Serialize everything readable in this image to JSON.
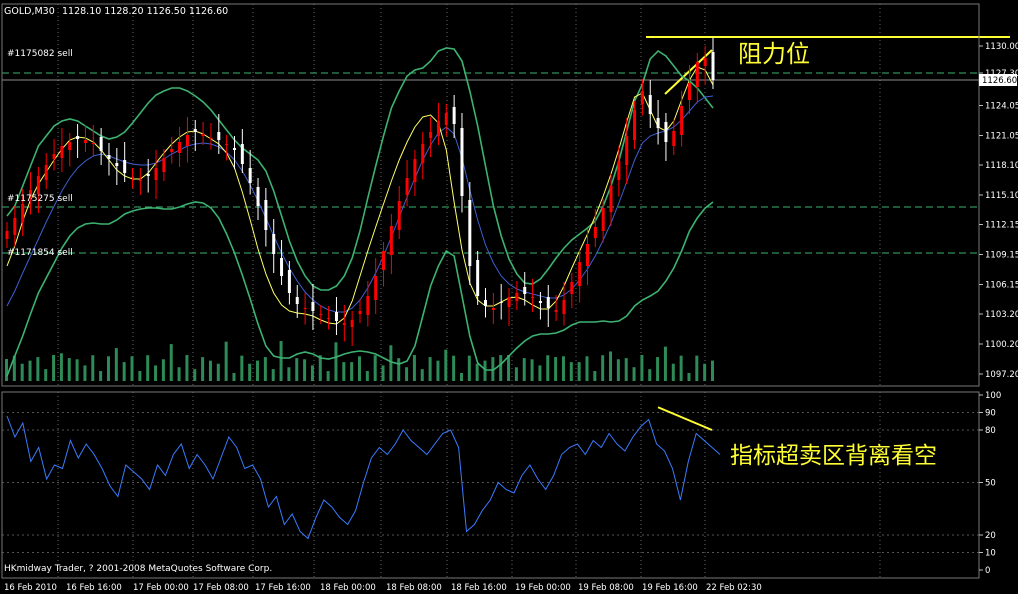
{
  "header": {
    "symbol_timeframe": "GOLD,M30",
    "ohlc": "1128.10 1128.20 1126.50 1126.60"
  },
  "orders": [
    {
      "label": "#1175082 sell",
      "price": 1127.3
    },
    {
      "label": "#1175275 sell",
      "price": 1113.9
    },
    {
      "label": "#1171854 sell",
      "price": 1109.3
    }
  ],
  "annotations": {
    "resistance": "阻力位",
    "divergence": "指标超卖区背离看空"
  },
  "footer": {
    "copyright": "HKmidway Trader, ? 2001-2008 MetaQuotes Software Corp."
  },
  "colors": {
    "background": "#000000",
    "bull_candle": "#ff0000",
    "bear_candle": "#ffffff",
    "bollinger": "#3cb371",
    "ma_yellow": "#ffff66",
    "ma_blue": "#3d5fd0",
    "oscillator": "#3a7bff",
    "annotation": "#ffff33",
    "grid": "#3cb371"
  },
  "chart_data": [
    {
      "type": "candlestick",
      "symbol": "GOLD",
      "timeframe": "M30",
      "ylim": [
        1096.5,
        1131.6
      ],
      "price_ticks": [
        "1130.00",
        "1127.30",
        "1124.05",
        "1121.05",
        "1118.10",
        "1115.10",
        "1112.15",
        "1109.15",
        "1106.15",
        "1103.20",
        "1100.20",
        "1097.20"
      ],
      "current_price_label": "1126.60",
      "resistance_level": 1130.9,
      "x_ticks": [
        "16 Feb 2010",
        "16 Feb 16:00",
        "17 Feb 00:00",
        "17 Feb 08:00",
        "17 Feb 16:00",
        "18 Feb 00:00",
        "18 Feb 08:00",
        "18 Feb 16:00",
        "19 Feb 00:00",
        "19 Feb 08:00",
        "19 Feb 16:00",
        "22 Feb 02:30"
      ],
      "close": [
        1111.5,
        1112.8,
        1114.2,
        1115.6,
        1117.0,
        1118.1,
        1119.2,
        1120.0,
        1120.4,
        1120.7,
        1120.6,
        1120.3,
        1119.5,
        1118.7,
        1118.0,
        1117.3,
        1116.9,
        1116.6,
        1117.0,
        1117.8,
        1118.8,
        1119.7,
        1120.4,
        1121.1,
        1121.4,
        1121.2,
        1120.8,
        1120.6,
        1120.2,
        1119.6,
        1118.2,
        1116.3,
        1114.0,
        1111.6,
        1109.2,
        1107.0,
        1105.3,
        1104.2,
        1103.8,
        1103.5,
        1103.2,
        1102.8,
        1102.5,
        1102.3,
        1102.6,
        1103.5,
        1105.0,
        1107.0,
        1109.5,
        1112.0,
        1114.5,
        1116.8,
        1118.7,
        1120.2,
        1121.4,
        1122.5,
        1123.3,
        1122.2,
        1115.0,
        1108.0,
        1105.0,
        1104.0,
        1103.8,
        1104.3,
        1104.9,
        1105.3,
        1105.2,
        1104.9,
        1104.3,
        1103.8,
        1103.6,
        1104.6,
        1106.4,
        1108.4,
        1110.2,
        1111.9,
        1113.8,
        1116.0,
        1118.5,
        1121.0,
        1123.6,
        1125.5,
        1123.2,
        1121.8,
        1120.4,
        1121.5,
        1124.0,
        1126.3,
        1128.4,
        1128.8,
        1126.6
      ],
      "bollinger_upper": [
        1113,
        1114,
        1116,
        1118,
        1120,
        1121,
        1122,
        1122.5,
        1122.7,
        1122.5,
        1122,
        1121.5,
        1121,
        1120.7,
        1120.9,
        1121.4,
        1122.3,
        1123.3,
        1124.3,
        1125.1,
        1125.5,
        1125.8,
        1125.8,
        1125.5,
        1125,
        1124.4,
        1123.6,
        1122.6,
        1121.6,
        1120.6,
        1119.8,
        1119.2,
        1118.6,
        1117.5,
        1115.5,
        1113,
        1110.5,
        1108.5,
        1107,
        1106,
        1105.6,
        1105.6,
        1106,
        1107,
        1108.8,
        1111.5,
        1114.8,
        1118,
        1121,
        1123.8,
        1125.5,
        1127,
        1127.6,
        1127.8,
        1128.5,
        1129.5,
        1129.8,
        1129.7,
        1128.5,
        1125.5,
        1122,
        1118,
        1114,
        1111,
        1108.7,
        1107.2,
        1106.3,
        1106.2,
        1106.7,
        1107.7,
        1108.8,
        1109.8,
        1110.6,
        1111.2,
        1111.8,
        1112.5,
        1114,
        1116,
        1118.5,
        1121.5,
        1124.5,
        1126.2,
        1128.7,
        1129.5,
        1129,
        1128,
        1127,
        1126.5,
        1125.8,
        1124.8,
        1123.8
      ],
      "bollinger_lower": [
        1097,
        1099,
        1101,
        1103.2,
        1105.3,
        1106.8,
        1108.3,
        1109.8,
        1111,
        1111.8,
        1112.2,
        1112.3,
        1112.2,
        1112.2,
        1112.6,
        1113.2,
        1113.5,
        1113.7,
        1113.8,
        1113.8,
        1113.7,
        1113.7,
        1113.9,
        1114.2,
        1114.4,
        1114.3,
        1113.8,
        1112.8,
        1111.2,
        1109.3,
        1107.1,
        1104.7,
        1102.2,
        1100,
        1099,
        1098.8,
        1098.8,
        1099.2,
        1099.4,
        1099.2,
        1098.8,
        1098.7,
        1098.9,
        1099.2,
        1099.4,
        1099.5,
        1099.4,
        1099.2,
        1098.8,
        1098.4,
        1098.2,
        1098.5,
        1100,
        1103,
        1106,
        1108,
        1109.5,
        1109,
        1105,
        1101,
        1098.3,
        1097.6,
        1097.6,
        1098.2,
        1099,
        1099.8,
        1100.5,
        1101,
        1101.2,
        1101.2,
        1101.3,
        1101.6,
        1102.1,
        1102.4,
        1102.4,
        1102.4,
        1102.5,
        1102.4,
        1102.5,
        1103,
        1104,
        1104.6,
        1105,
        1105.5,
        1106.5,
        1107.8,
        1109.5,
        1111.5,
        1112.8,
        1113.8,
        1114.4
      ],
      "ma_fast": [
        1108,
        1110,
        1112.5,
        1114.6,
        1116.2,
        1117.4,
        1118.6,
        1119.7,
        1120.6,
        1120.9,
        1120.8,
        1120.4,
        1119.6,
        1118.6,
        1117.6,
        1117,
        1116.7,
        1116.7,
        1117.3,
        1118.3,
        1119.3,
        1120.2,
        1120.9,
        1121.4,
        1121.5,
        1121.2,
        1120.7,
        1120.2,
        1119.3,
        1117.8,
        1115.4,
        1112.6,
        1109.7,
        1107.2,
        1105.3,
        1104.1,
        1103.5,
        1103.3,
        1103.2,
        1103,
        1102.6,
        1102.3,
        1102.2,
        1102.8,
        1104.5,
        1107,
        1109.5,
        1111.9,
        1114.2,
        1116.5,
        1118.6,
        1120.4,
        1121.9,
        1122.9,
        1123.1,
        1122.3,
        1119.6,
        1114.4,
        1109.6,
        1106.3,
        1104.6,
        1104,
        1104,
        1104.4,
        1104.8,
        1104.9,
        1104.6,
        1104.1,
        1103.7,
        1103.7,
        1104.5,
        1106,
        1107.8,
        1109.5,
        1111.2,
        1113,
        1115,
        1117.2,
        1119.7,
        1122.4,
        1124.9,
        1125.3,
        1123.6,
        1121.9,
        1121.5,
        1122.5,
        1124.6,
        1126.6,
        1127.9,
        1127.6,
        1126.1
      ],
      "ma_blue": [
        1104,
        1105.5,
        1107.3,
        1109,
        1110.7,
        1112.4,
        1114,
        1115.5,
        1116.8,
        1117.8,
        1118.5,
        1119,
        1119.2,
        1119,
        1118.7,
        1118.4,
        1118.2,
        1118.1,
        1118.1,
        1118.3,
        1118.7,
        1119.2,
        1119.6,
        1120,
        1120.2,
        1120.3,
        1120.2,
        1119.9,
        1119.4,
        1118.6,
        1117.5,
        1116.1,
        1114.5,
        1112.8,
        1111,
        1109.3,
        1107.8,
        1106.5,
        1105.4,
        1104.6,
        1104,
        1103.6,
        1103.4,
        1103.4,
        1103.8,
        1104.6,
        1105.8,
        1107.3,
        1109,
        1110.9,
        1112.9,
        1114.9,
        1116.8,
        1118.6,
        1120.1,
        1121.3,
        1121.9,
        1121.2,
        1118.8,
        1115.6,
        1112.6,
        1110.1,
        1108.3,
        1107,
        1106.2,
        1105.7,
        1105.4,
        1105.2,
        1105,
        1104.8,
        1104.8,
        1105.1,
        1105.7,
        1106.6,
        1107.7,
        1109,
        1110.6,
        1112.3,
        1114.3,
        1116.4,
        1118.6,
        1120.3,
        1121,
        1121.3,
        1121.5,
        1121.9,
        1122.6,
        1123.5,
        1124.4,
        1124.9,
        1125
      ]
    },
    {
      "type": "line",
      "name": "oscillator",
      "ylim": [
        -3,
        103
      ],
      "y_ticks": [
        "100",
        "90",
        "80",
        "50",
        "20",
        "10",
        "0"
      ],
      "x_ticks": [
        "16 Feb 2010",
        "16 Feb 16:00",
        "17 Feb 00:00",
        "17 Feb 08:00",
        "17 Feb 16:00",
        "18 Feb 00:00",
        "18 Feb 08:00",
        "18 Feb 16:00",
        "19 Feb 00:00",
        "19 Feb 08:00",
        "19 Feb 16:00",
        "22 Feb 02:30"
      ],
      "values": [
        88,
        76,
        84,
        62,
        70,
        52,
        60,
        58,
        74,
        64,
        72,
        66,
        58,
        48,
        42,
        60,
        56,
        52,
        46,
        60,
        54,
        66,
        72,
        58,
        66,
        60,
        52,
        64,
        76,
        70,
        58,
        60,
        52,
        36,
        42,
        26,
        32,
        22,
        18,
        30,
        40,
        36,
        30,
        26,
        34,
        50,
        64,
        70,
        66,
        72,
        80,
        74,
        70,
        66,
        72,
        78,
        80,
        70,
        22,
        26,
        34,
        40,
        50,
        46,
        44,
        54,
        60,
        52,
        46,
        54,
        66,
        70,
        72,
        66,
        74,
        70,
        78,
        72,
        68,
        76,
        82,
        86,
        72,
        68,
        58,
        40,
        62,
        78,
        74,
        70,
        66
      ]
    }
  ]
}
